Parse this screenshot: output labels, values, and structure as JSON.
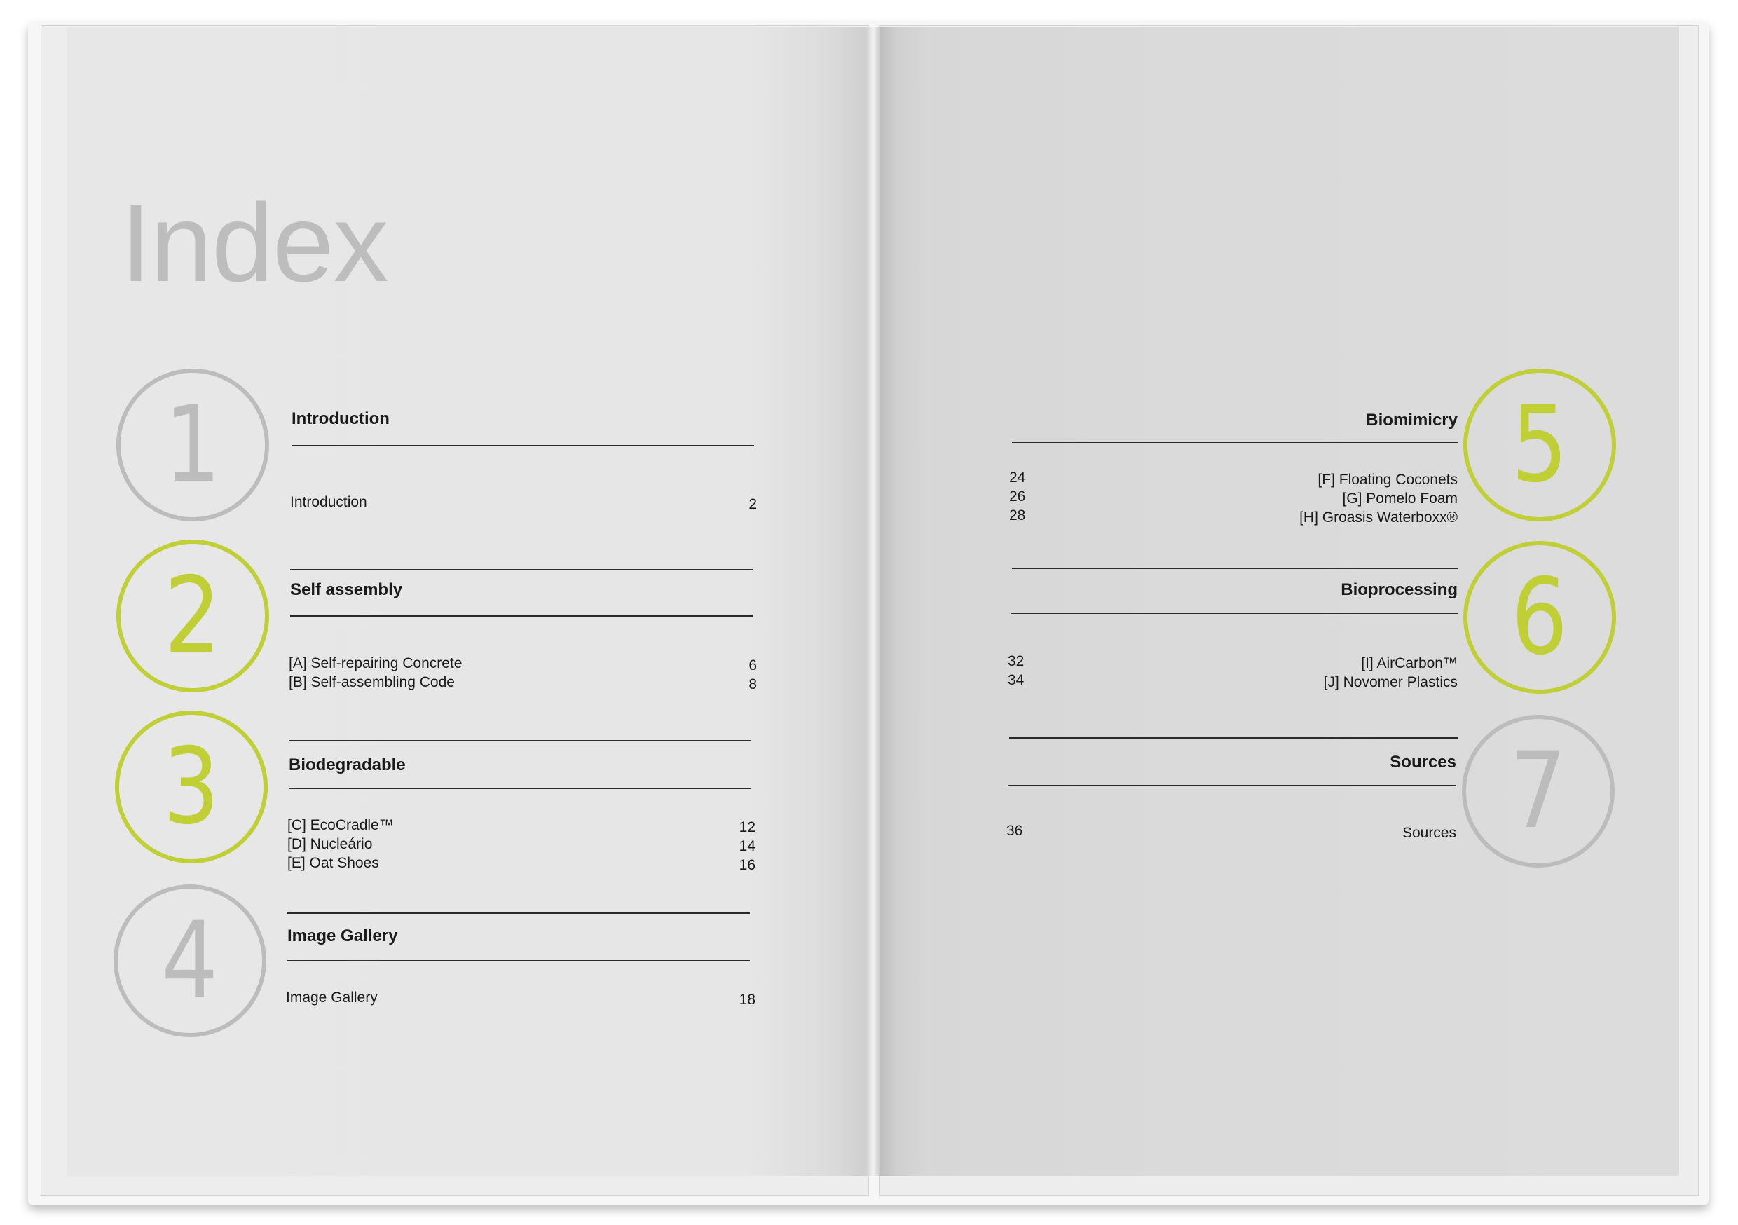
{
  "document": {
    "title": "Index",
    "accent_color": "#c0cf35",
    "muted_color": "#bcbcbc"
  },
  "sections": [
    {
      "number": "1",
      "heading": "Introduction",
      "accent": false,
      "entries": [
        "Introduction"
      ],
      "pages": [
        "2"
      ]
    },
    {
      "number": "2",
      "heading": "Self assembly",
      "accent": true,
      "entries": [
        "[A] Self-repairing Concrete",
        "[B] Self-assembling Code"
      ],
      "pages": [
        "6",
        "8"
      ]
    },
    {
      "number": "3",
      "heading": "Biodegradable",
      "accent": true,
      "entries": [
        "[C] EcoCradle™",
        "[D] Nucleário",
        "[E] Oat Shoes"
      ],
      "pages": [
        "12",
        "14",
        "16"
      ]
    },
    {
      "number": "4",
      "heading": "Image Gallery",
      "accent": false,
      "entries": [
        "Image Gallery"
      ],
      "pages": [
        "18"
      ]
    },
    {
      "number": "5",
      "heading": "Biomimicry",
      "accent": true,
      "entries": [
        "[F] Floating Coconets",
        "[G] Pomelo Foam",
        "[H] Groasis Waterboxx®"
      ],
      "pages": [
        "24",
        "26",
        "28"
      ]
    },
    {
      "number": "6",
      "heading": "Bioprocessing",
      "accent": true,
      "entries": [
        "[I] AirCarbon™",
        "[J] Novomer Plastics"
      ],
      "pages": [
        "32",
        "34"
      ]
    },
    {
      "number": "7",
      "heading": "Sources",
      "accent": false,
      "entries": [
        "Sources"
      ],
      "pages": [
        "36"
      ]
    }
  ]
}
